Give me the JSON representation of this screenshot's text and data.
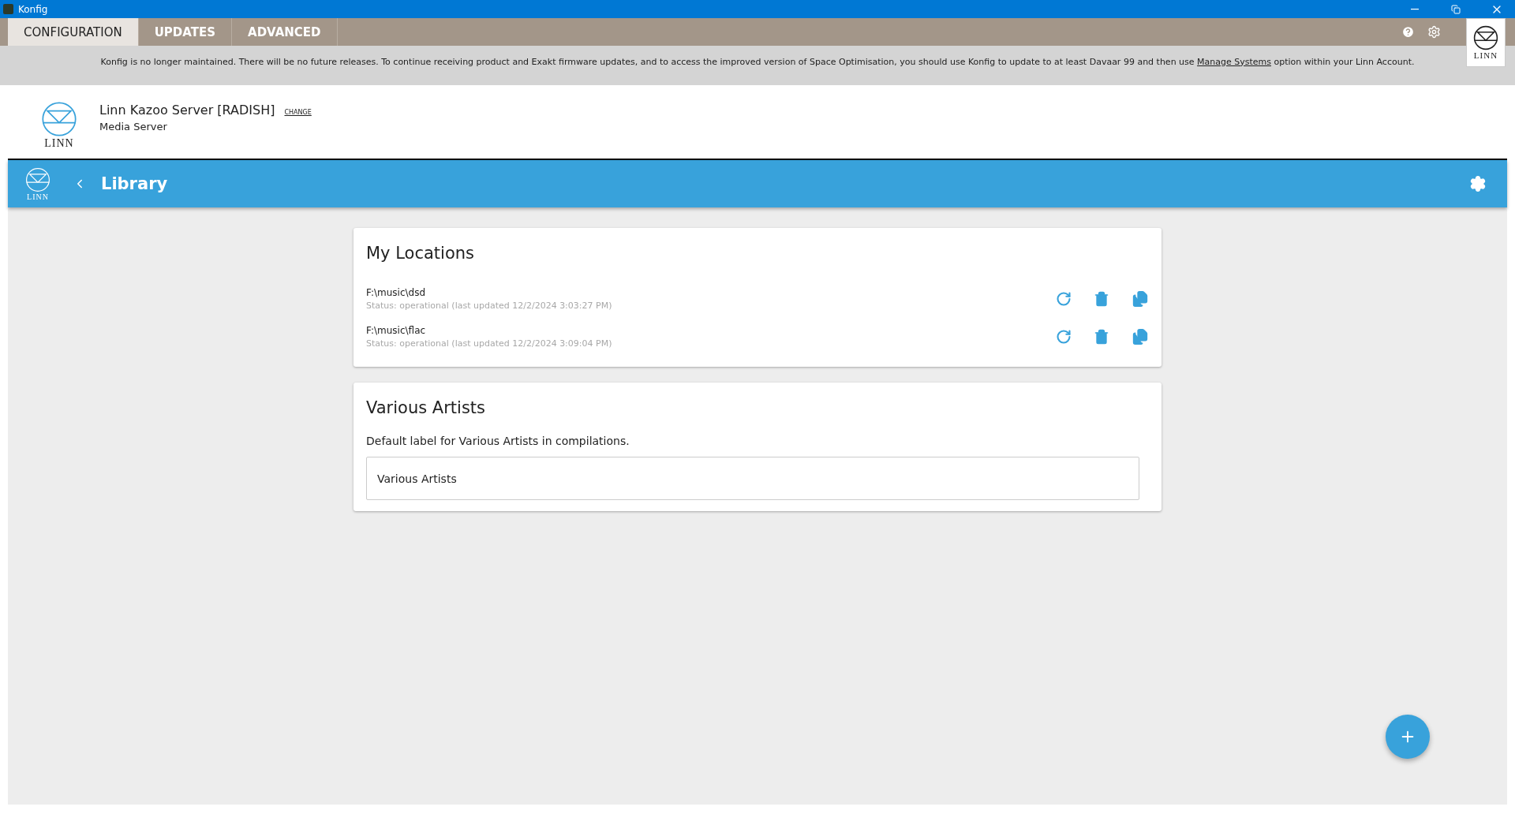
{
  "window": {
    "title": "Konfig"
  },
  "tabs": [
    {
      "label": "CONFIGURATION",
      "selected": true
    },
    {
      "label": "UPDATES",
      "selected": false
    },
    {
      "label": "ADVANCED",
      "selected": false
    }
  ],
  "notice": {
    "before": "Konfig is no longer maintained. There will be no future releases. To continue receiving product and Exakt firmware updates, and to access the improved version of Space Optimisation, you should use Konfig to update to at least Davaar 99 and then use",
    "link": "Manage Systems",
    "after": "option within your Linn Account."
  },
  "corner_logo": {
    "text": "LINN"
  },
  "device": {
    "logo_text": "LINN",
    "name": "Linn Kazoo Server [RADISH]",
    "change": "CHANGE",
    "type": "Media Server"
  },
  "page_bar": {
    "logo_text": "LINN",
    "title": "Library"
  },
  "locations": {
    "title": "My Locations",
    "items": [
      {
        "path": "F:\\music\\dsd",
        "status": "Status: operational (last updated 12/2/2024 3:03:27 PM)"
      },
      {
        "path": "F:\\music\\flac",
        "status": "Status: operational (last updated 12/2/2024 3:09:04 PM)"
      }
    ]
  },
  "various_artists": {
    "title": "Various Artists",
    "description": "Default label for Various Artists in compilations.",
    "value": "Various Artists"
  }
}
